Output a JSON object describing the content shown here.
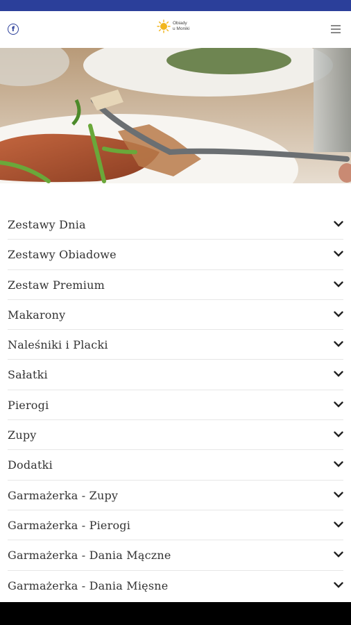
{
  "header": {
    "logo_line1": "Obiady",
    "logo_line2": "u Moniki",
    "icons": [
      "facebook-icon",
      "sun-logo-icon",
      "hamburger-menu-icon"
    ]
  },
  "hero": {
    "alt": "food-photo"
  },
  "categories": [
    {
      "label": "Zestawy Dnia"
    },
    {
      "label": "Zestawy Obiadowe"
    },
    {
      "label": "Zestaw Premium"
    },
    {
      "label": "Makarony"
    },
    {
      "label": "Naleśniki i Placki"
    },
    {
      "label": "Sałatki"
    },
    {
      "label": "Pierogi"
    },
    {
      "label": "Zupy"
    },
    {
      "label": "Dodatki"
    },
    {
      "label": "Garmażerka - Zupy"
    },
    {
      "label": "Garmażerka - Pierogi"
    },
    {
      "label": "Garmażerka - Dania Mączne"
    },
    {
      "label": "Garmażerka - Dania Mięsne"
    }
  ],
  "colors": {
    "status_bar": "#2b3f9a",
    "accent": "#2b3f9a",
    "logo_sun": "#f2b61c"
  }
}
